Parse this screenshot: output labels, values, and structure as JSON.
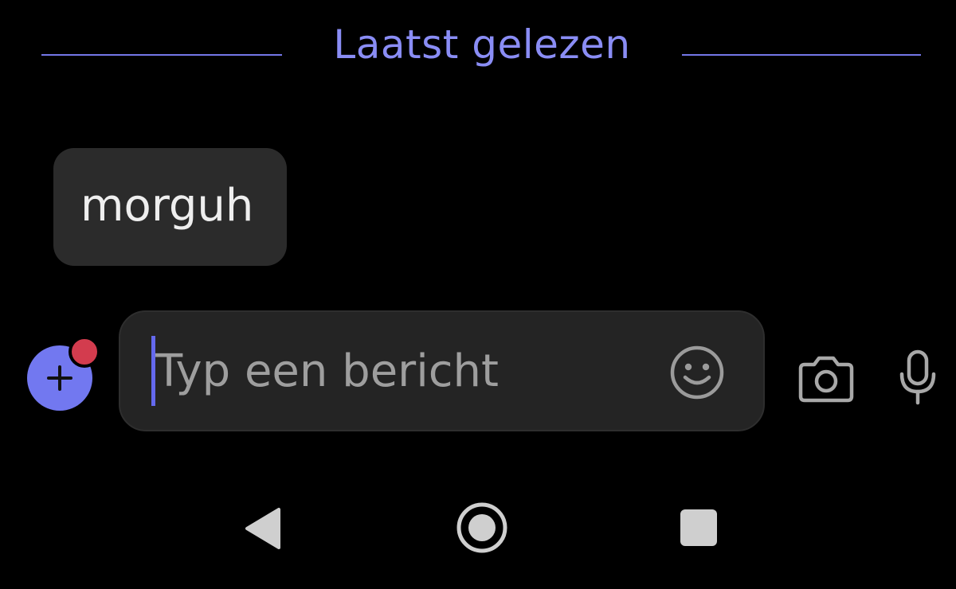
{
  "divider": {
    "label": "Laatst gelezen"
  },
  "messages": [
    {
      "text": "morguh",
      "direction": "received"
    }
  ],
  "composer": {
    "placeholder": "Typ een bericht",
    "value": "",
    "attach_icon": "plus-icon",
    "emoji_icon": "smiley-icon",
    "camera_icon": "camera-icon",
    "mic_icon": "microphone-icon",
    "badge_visible": true
  },
  "navigation": {
    "back_icon": "back-triangle-icon",
    "home_icon": "home-circle-icon",
    "recents_icon": "recents-square-icon"
  },
  "colors": {
    "background": "#000000",
    "accent": "#7278f0",
    "divider": "#8a8df5",
    "badge": "#d33c4e",
    "bubble": "#2b2b2b",
    "input": "#242424"
  }
}
